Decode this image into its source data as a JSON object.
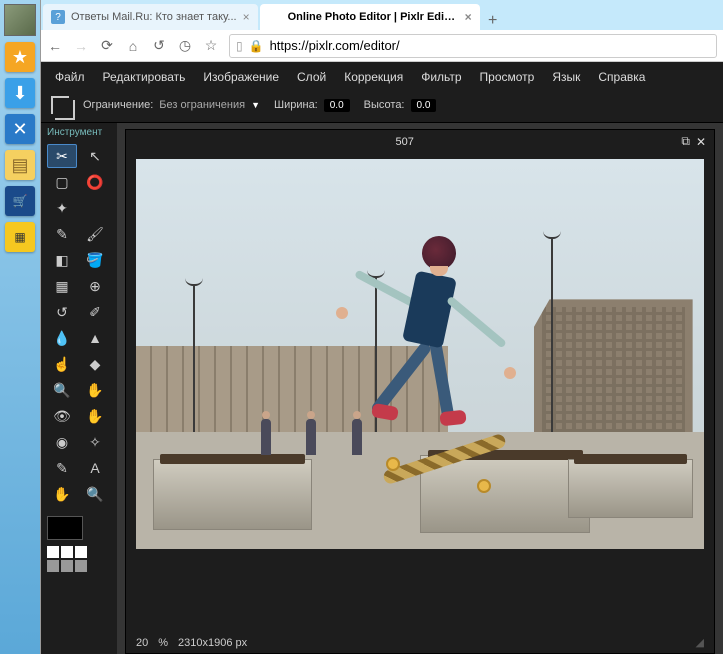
{
  "os_sidebar": [
    {
      "name": "avatar",
      "bg": ""
    },
    {
      "name": "star-icon",
      "glyph": "★",
      "bg": "#f5a623"
    },
    {
      "name": "download-icon",
      "glyph": "⬇",
      "bg": "#3aa0e8"
    },
    {
      "name": "tools-icon",
      "glyph": "✕",
      "bg": "#2a7ac8"
    },
    {
      "name": "notes-icon",
      "glyph": "▤",
      "bg": "#f5d060"
    },
    {
      "name": "cart-icon",
      "glyph": "🛒",
      "bg": "#1a4a8a"
    },
    {
      "name": "taxi-icon",
      "glyph": "▦",
      "bg": "#f5c820"
    }
  ],
  "tabs": {
    "inactive": {
      "title": "Ответы Mail.Ru: Кто знает таку...",
      "favicon_bg": "#5aa0d8",
      "favicon_glyph": "?"
    },
    "active": {
      "title": "Online Photo Editor | Pixlr Editor | ...",
      "favicon_bg": "#fff",
      "favicon_glyph": ""
    }
  },
  "address_bar": {
    "url": "https://pixlr.com/editor/"
  },
  "menu": [
    "Файл",
    "Редактировать",
    "Изображение",
    "Слой",
    "Коррекция",
    "Фильтр",
    "Просмотр",
    "Язык",
    "Справка"
  ],
  "options_bar": {
    "constraint_label": "Ограничение:",
    "constraint_value": "Без ограничения",
    "width_label": "Ширина:",
    "width_value": "0.0",
    "height_label": "Высота:",
    "height_value": "0.0"
  },
  "toolbox_label": "Инструмент",
  "tools": [
    {
      "name": "crop-tool",
      "glyph": "✂",
      "sel": true
    },
    {
      "name": "move-tool",
      "glyph": "↖"
    },
    {
      "name": "marquee-tool",
      "glyph": "▢"
    },
    {
      "name": "lasso-tool",
      "glyph": "⭕"
    },
    {
      "name": "wand-tool",
      "glyph": "✦"
    },
    {
      "name": "",
      "glyph": ""
    },
    {
      "name": "pencil-tool",
      "glyph": "✎"
    },
    {
      "name": "brush-tool",
      "glyph": "🖌"
    },
    {
      "name": "eraser-tool",
      "glyph": "◧"
    },
    {
      "name": "bucket-tool",
      "glyph": "🪣"
    },
    {
      "name": "gradient-tool",
      "glyph": "▦"
    },
    {
      "name": "stamp-tool",
      "glyph": "⊕"
    },
    {
      "name": "replace-tool",
      "glyph": "↺"
    },
    {
      "name": "draw-tool",
      "glyph": "✐"
    },
    {
      "name": "blur-tool",
      "glyph": "💧"
    },
    {
      "name": "sharpen-tool",
      "glyph": "▲"
    },
    {
      "name": "smudge-tool",
      "glyph": "☝"
    },
    {
      "name": "sponge-tool",
      "glyph": "◆"
    },
    {
      "name": "dodge-tool",
      "glyph": "🔍"
    },
    {
      "name": "burn-tool",
      "glyph": "✋"
    },
    {
      "name": "redeye-tool",
      "glyph": "👁"
    },
    {
      "name": "spot-tool",
      "glyph": "✋"
    },
    {
      "name": "bloat-tool",
      "glyph": "◉"
    },
    {
      "name": "pinch-tool",
      "glyph": "✧"
    },
    {
      "name": "picker-tool",
      "glyph": "✎"
    },
    {
      "name": "type-tool",
      "glyph": "A"
    },
    {
      "name": "hand-tool",
      "glyph": "✋"
    },
    {
      "name": "zoom-tool",
      "glyph": "🔍"
    }
  ],
  "canvas": {
    "title": "507"
  },
  "status": {
    "zoom": "20",
    "zoom_unit": "%",
    "dimensions": "2310x1906 px"
  }
}
